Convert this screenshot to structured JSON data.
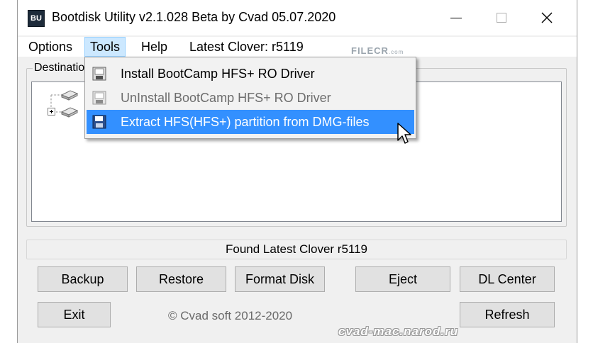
{
  "window": {
    "title": "Bootdisk Utility v2.1.028 Beta by Cvad 05.07.2020",
    "icon_text": "BU",
    "controls": {
      "minimize": "minimize-icon",
      "maximize": "maximize-icon",
      "close": "close-icon"
    }
  },
  "menubar": {
    "options": "Options",
    "tools": "Tools",
    "help": "Help",
    "latest_clover": "Latest Clover: r5119"
  },
  "watermark": {
    "brand": "FILECR",
    "domain": ".com"
  },
  "destination": {
    "label": "Destination"
  },
  "tools_menu": {
    "items": [
      {
        "label": "Install BootCamp HFS+ RO Driver",
        "icon": "driver-icon",
        "state": "normal"
      },
      {
        "label": "UnInstall BootCamp HFS+ RO Driver",
        "icon": "driver-icon",
        "state": "disabled"
      },
      {
        "label": "Extract HFS(HFS+) partition from DMG-files",
        "icon": "floppy-disk-icon",
        "state": "selected"
      }
    ]
  },
  "status": {
    "text": "Found Latest Clover r5119"
  },
  "buttons": {
    "backup": "Backup",
    "restore": "Restore",
    "format_disk": "Format Disk",
    "eject": "Eject",
    "dl_center": "DL Center",
    "exit": "Exit",
    "refresh": "Refresh"
  },
  "footer": {
    "copyright": "© Cvad soft 2012-2020",
    "site": "cvad-mac.narod.ru"
  },
  "colors": {
    "selection": "#3390ff",
    "menu_hover": "#cce8ff",
    "window_bg": "#f0f0f0"
  }
}
